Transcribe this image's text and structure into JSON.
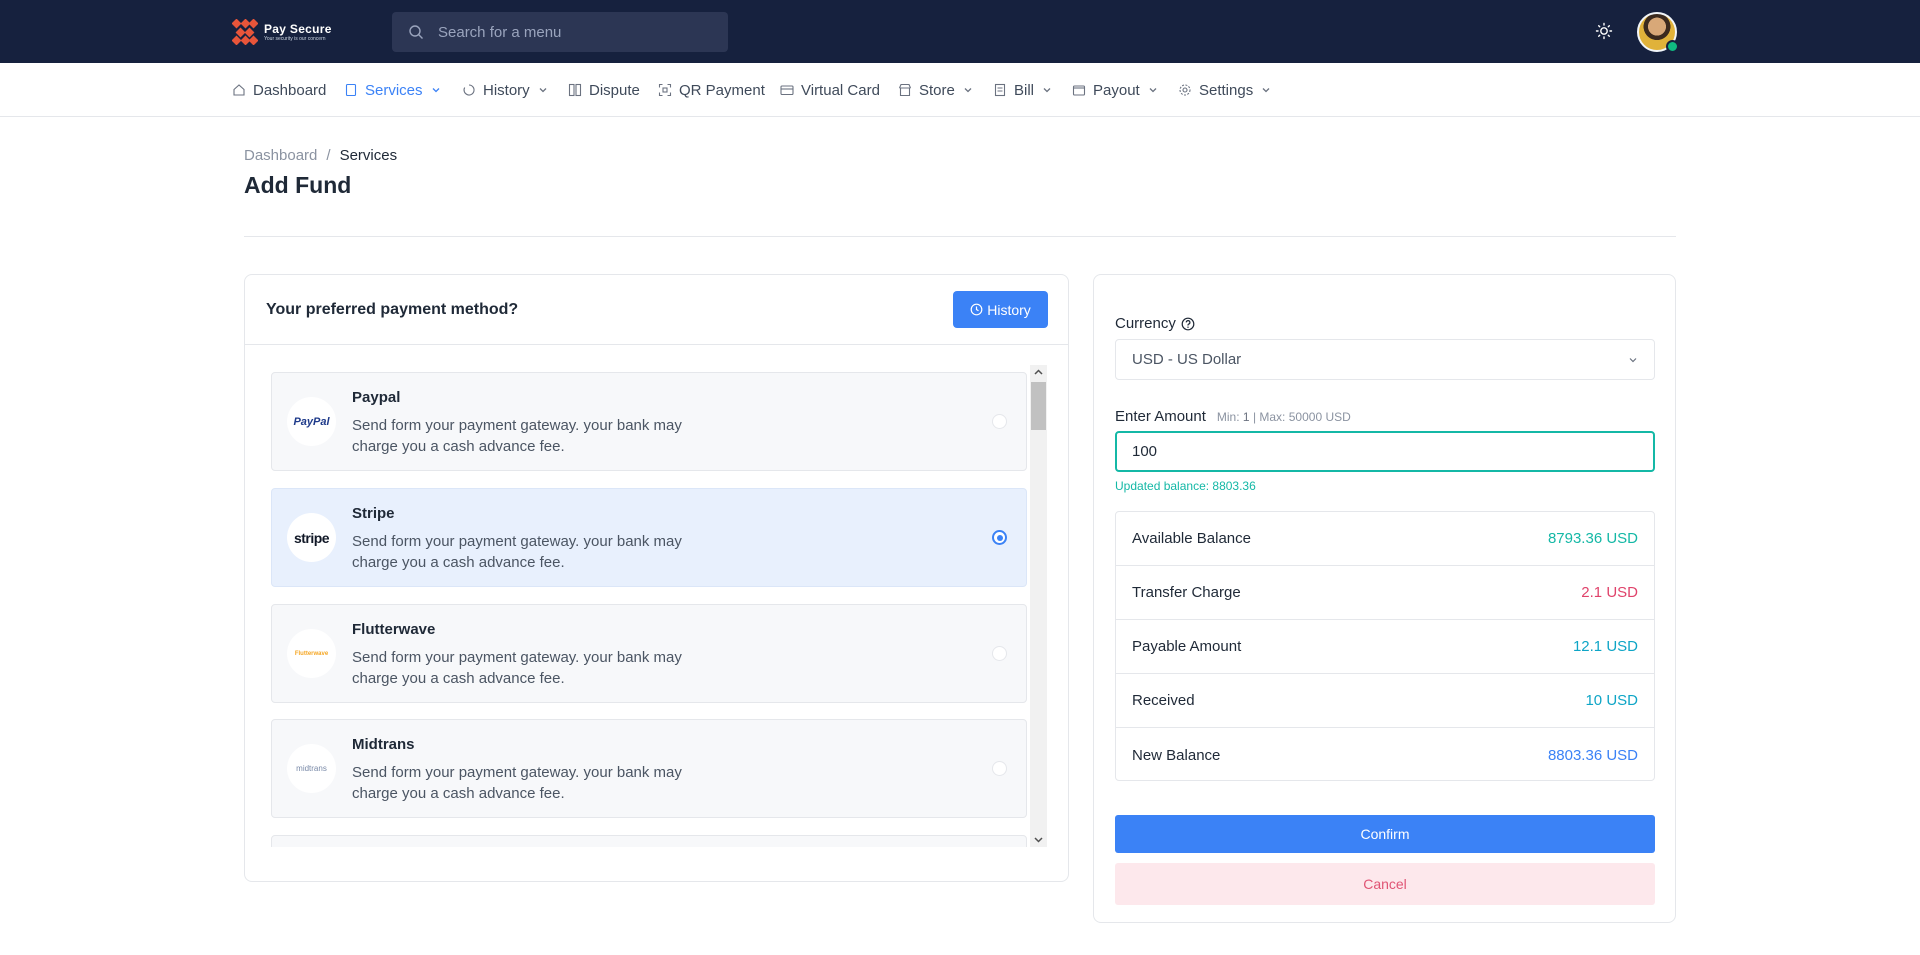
{
  "header": {
    "logo_title": "Pay Secure",
    "logo_tagline": "Your security is our concern",
    "search_placeholder": "Search for a menu"
  },
  "nav": {
    "items": [
      {
        "label": "Dashboard",
        "icon": "home-icon"
      },
      {
        "label": "Services",
        "icon": "file-icon",
        "active": true
      },
      {
        "label": "History",
        "icon": "history-icon"
      },
      {
        "label": "Dispute",
        "icon": "dispute-icon"
      },
      {
        "label": "QR Payment",
        "icon": "qr-icon"
      },
      {
        "label": "Virtual Card",
        "icon": "card-icon"
      },
      {
        "label": "Store",
        "icon": "store-icon"
      },
      {
        "label": "Bill",
        "icon": "bill-icon"
      },
      {
        "label": "Payout",
        "icon": "wallet-icon"
      },
      {
        "label": "Settings",
        "icon": "gear-icon"
      }
    ]
  },
  "breadcrumb": {
    "home": "Dashboard",
    "separator": "/",
    "current": "Services"
  },
  "page_title": "Add Fund",
  "methods_card": {
    "title": "Your preferred payment method?",
    "history_button": "History",
    "methods": [
      {
        "name": "Paypal",
        "logo": "PayPal",
        "desc": "Send form your payment gateway. your bank may charge you a cash advance fee.",
        "selected": false
      },
      {
        "name": "Stripe",
        "logo": "stripe",
        "desc": "Send form your payment gateway. your bank may charge you a cash advance fee.",
        "selected": true
      },
      {
        "name": "Flutterwave",
        "logo": "Flutterwave",
        "desc": "Send form your payment gateway. your bank may charge you a cash advance fee.",
        "selected": false
      },
      {
        "name": "Midtrans",
        "logo": "midtrans",
        "desc": "Send form your payment gateway. your bank may charge you a cash advance fee.",
        "selected": false
      }
    ]
  },
  "fund_form": {
    "currency_label": "Currency",
    "currency_value": "USD - US Dollar",
    "amount_label": "Enter Amount",
    "min_label": "Min:",
    "min_value": "1",
    "max_label": "| Max:",
    "max_value": "50000 USD",
    "amount_value": "100",
    "updated_balance": "Updated balance: 8803.36",
    "summary": [
      {
        "key": "Available Balance",
        "value": "8793.36 USD",
        "color": "#14b8a6"
      },
      {
        "key": "Transfer Charge",
        "value": "2.1 USD",
        "color": "#e0436b"
      },
      {
        "key": "Payable Amount",
        "value": "12.1 USD",
        "color": "#0ea5c6"
      },
      {
        "key": "Received",
        "value": "10 USD",
        "color": "#0ea5c6"
      },
      {
        "key": "New Balance",
        "value": "8803.36 USD",
        "color": "#3b82f6"
      }
    ],
    "confirm_label": "Confirm",
    "cancel_label": "Cancel"
  },
  "colors": {
    "header_bg": "#16213e",
    "accent": "#3b82f6",
    "success": "#14b8a6",
    "danger": "#e0436b"
  }
}
